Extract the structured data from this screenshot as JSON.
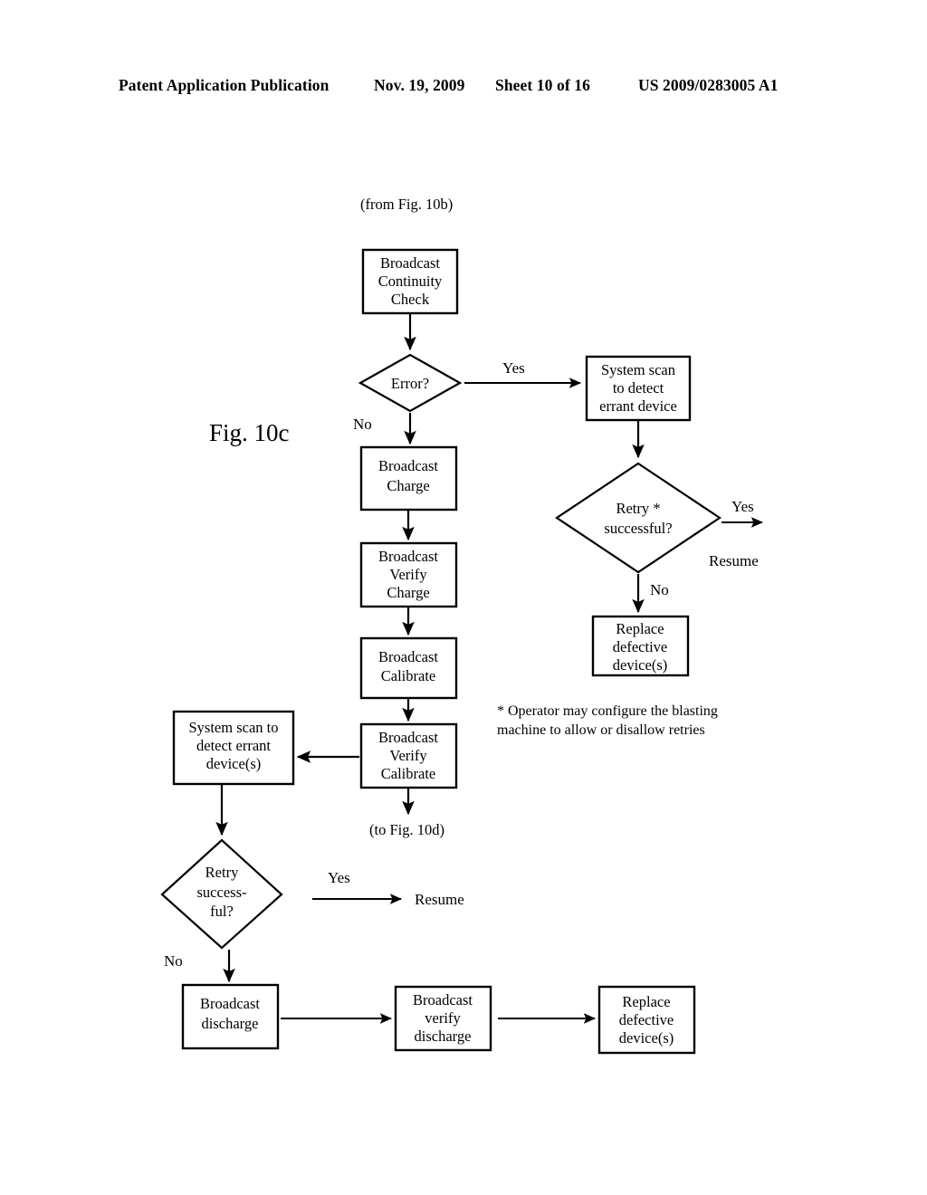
{
  "header": {
    "title": "Patent Application Publication",
    "date": "Nov. 19, 2009",
    "sheet": "Sheet 10 of 16",
    "number": "US 2009/0283005 A1"
  },
  "figure": {
    "label": "Fig. 10c",
    "entry_ref": "(from Fig. 10b)",
    "exit_ref": "(to Fig. 10d)",
    "footnote": {
      "line1": "* Operator may configure the blasting",
      "line2": "machine to allow or disallow retries"
    }
  },
  "nodes": {
    "broadcast_continuity_check": {
      "line1": "Broadcast",
      "line2": "Continuity",
      "line3": "Check"
    },
    "error_decision": {
      "line1": "Error?"
    },
    "system_scan_errant_device": {
      "line1": "System scan",
      "line2": "to detect",
      "line3": "errant device"
    },
    "broadcast_charge": {
      "line1": "Broadcast",
      "line2": "Charge"
    },
    "retry_successful_top": {
      "line1": "Retry *",
      "line2": "successful?"
    },
    "broadcast_verify_charge": {
      "line1": "Broadcast",
      "line2": "Verify",
      "line3": "Charge"
    },
    "replace_defective_device_top": {
      "line1": "Replace",
      "line2": "defective",
      "line3": "device(s)"
    },
    "broadcast_calibrate": {
      "line1": "Broadcast",
      "line2": "Calibrate"
    },
    "system_scan_errant_devices_left": {
      "line1": "System scan to",
      "line2": "detect errant",
      "line3": "device(s)"
    },
    "broadcast_verify_calibrate": {
      "line1": "Broadcast",
      "line2": "Verify",
      "line3": "Calibrate"
    },
    "retry_successful_bottom": {
      "line1": "Retry",
      "line2": "success-",
      "line3": "ful?"
    },
    "broadcast_discharge": {
      "line1": "Broadcast",
      "line2": "discharge"
    },
    "broadcast_verify_discharge": {
      "line1": "Broadcast",
      "line2": "verify",
      "line3": "discharge"
    },
    "replace_defective_device_bottom": {
      "line1": "Replace",
      "line2": "defective",
      "line3": "device(s)"
    }
  },
  "edge_labels": {
    "error_yes": "Yes",
    "error_no": "No",
    "retry_top_yes": "Yes",
    "retry_top_no": "No",
    "retry_top_resume": "Resume",
    "retry_bottom_yes": "Yes",
    "retry_bottom_no": "No",
    "retry_bottom_resume": "Resume"
  },
  "colors": {
    "ink": "#000000",
    "paper": "#ffffff"
  }
}
